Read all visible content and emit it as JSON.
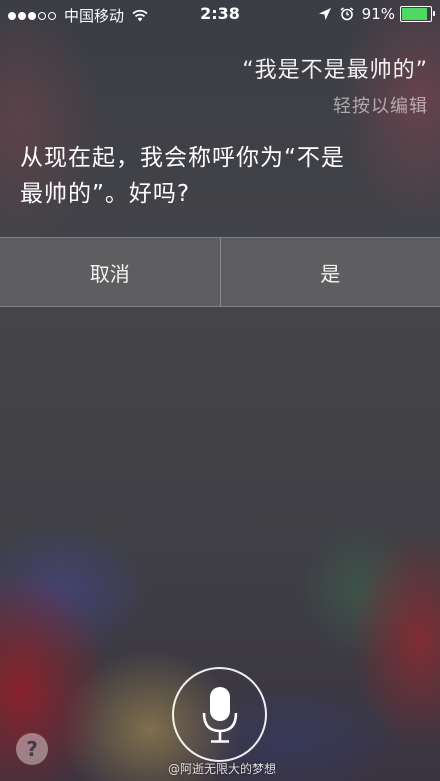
{
  "status_bar": {
    "carrier": "中国移动",
    "time": "2:38",
    "battery_percent": "91%",
    "battery_level": 0.91,
    "signal_strength_dots": 3,
    "signal_total_dots": 5,
    "icons": [
      "wifi-icon",
      "location-icon",
      "alarm-icon",
      "battery-icon"
    ]
  },
  "conversation": {
    "user_query": "“我是不是最帅的”",
    "edit_hint": "轻按以编辑",
    "siri_reply_line1": "从现在起，我会称呼你为“不是",
    "siri_reply_line2": "最帅的”。好吗?"
  },
  "choices": {
    "cancel_label": "取消",
    "confirm_label": "是"
  },
  "controls": {
    "help_label": "?",
    "mic_icon": "microphone-icon"
  },
  "watermark": "@阿逝无限大的梦想",
  "colors": {
    "battery_fill": "#4cd964",
    "text": "#ffffff"
  }
}
